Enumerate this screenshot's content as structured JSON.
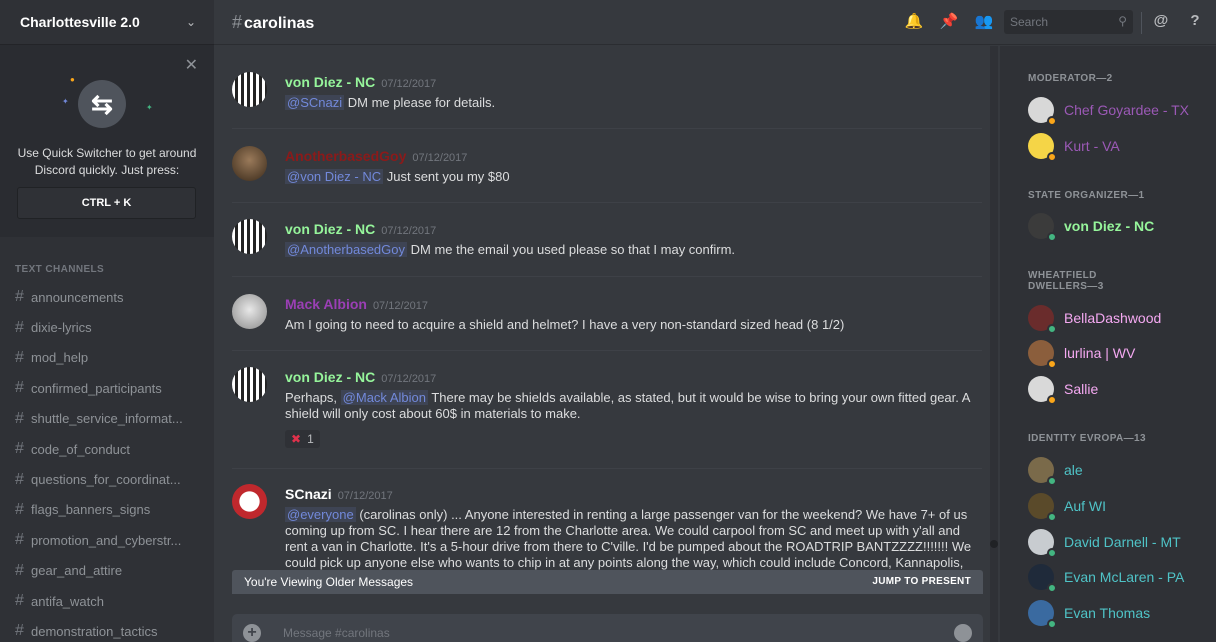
{
  "server": {
    "name": "Charlottesville 2.0"
  },
  "quick_switcher": {
    "text": "Use Quick Switcher to get around Discord quickly. Just press:",
    "shortcut": "CTRL + K"
  },
  "channels": {
    "category": "TEXT CHANNELS",
    "items": [
      "announcements",
      "dixie-lyrics",
      "mod_help",
      "confirmed_participants",
      "shuttle_service_informat...",
      "code_of_conduct",
      "questions_for_coordinat...",
      "flags_banners_signs",
      "promotion_and_cyberstr...",
      "gear_and_attire",
      "antifa_watch",
      "demonstration_tactics"
    ]
  },
  "header": {
    "channel": "carolinas",
    "search_placeholder": "Search",
    "at_label": "@",
    "help_label": "?"
  },
  "messages": [
    {
      "user": "von Diez - NC",
      "color": "#96f59b",
      "time": "07/12/2017",
      "mention": "@SCnazi",
      "text": "DM me please for details."
    },
    {
      "user": "AnotherbasedGoy",
      "color": "#8b1a1a",
      "time": "07/12/2017",
      "mention": "@von Diez - NC",
      "text": "Just sent you my $80"
    },
    {
      "user": "von Diez - NC",
      "color": "#96f59b",
      "time": "07/12/2017",
      "mention": "@AnotherbasedGoy",
      "text": "DM me the email you used please so that I may confirm."
    },
    {
      "user": "Mack Albion",
      "color": "#9b3fb5",
      "time": "07/12/2017",
      "mention": "",
      "text": "Am I going to need to acquire a shield and helmet? I have a very non-standard sized head (8 1/2)"
    },
    {
      "user": "von Diez - NC",
      "color": "#96f59b",
      "time": "07/12/2017",
      "mention_pre": "Perhaps,",
      "mention": "@Mack Albion",
      "text": "There may be shields available, as stated, but it would be wise to bring your own fitted gear. A shield will only cost about 60$ in materials to make.",
      "reaction_count": "1"
    },
    {
      "user": "SCnazi",
      "color": "#ffffff",
      "time": "07/12/2017",
      "mention": "@everyone",
      "text": "(carolinas only) ... Anyone interested in renting a large passenger van for the weekend? We have 7+ of us coming up from SC. I hear there are 12 from the Charlotte area. We could carpool from SC and meet up with y'all and rent a van in Charlotte. It's a 5-hour drive from there to C'ville. I'd be pumped about the ROADTRIP BANTZZZZ!!!!!!! We could pick up anyone else who wants to chip in at any points along the way, which could include Concord, Kannapolis, Salisbury, Lexington, Thomasville, High Point, Greensboro, Reidsville, etc. Alternately, if the demand"
    }
  ],
  "older_bar": {
    "text": "You're Viewing Older Messages",
    "jump": "JUMP TO PRESENT"
  },
  "composer": {
    "placeholder": "Message #carolinas"
  },
  "members": {
    "groups": [
      {
        "label": "MODERATOR—2",
        "items": [
          {
            "name": "Chef Goyardee - TX",
            "color": "#9b59b6",
            "status": "#faa61a",
            "av": "#d8d8d8"
          },
          {
            "name": "Kurt - VA",
            "color": "#9b59b6",
            "status": "#faa61a",
            "av": "#f5d547"
          }
        ]
      },
      {
        "label": "STATE ORGANIZER—1",
        "items": [
          {
            "name": "von Diez - NC",
            "color": "#96f59b",
            "status": "#43b581",
            "av": "#3b3b3b"
          }
        ]
      },
      {
        "label": "WHEATFIELD DWELLERS—3",
        "items": [
          {
            "name": "BellaDashwood",
            "color": "#f5a9f2",
            "status": "#43b581",
            "av": "#6a2c2c"
          },
          {
            "name": "lurlina | WV",
            "color": "#f5a9f2",
            "status": "#faa61a",
            "av": "#8b5e3c"
          },
          {
            "name": "Sallie",
            "color": "#f5a9f2",
            "status": "#faa61a",
            "av": "#d9d9d9"
          }
        ]
      },
      {
        "label": "IDENTITY EVROPA—13",
        "items": [
          {
            "name": "ale",
            "color": "#4fc3c7",
            "status": "#43b581",
            "av": "#7a6a4a"
          },
          {
            "name": "Auf WI",
            "color": "#4fc3c7",
            "status": "#43b581",
            "av": "#5a4a2a"
          },
          {
            "name": "David Darnell - MT",
            "color": "#4fc3c7",
            "status": "#43b581",
            "av": "#c8ccd0"
          },
          {
            "name": "Evan McLaren - PA",
            "color": "#4fc3c7",
            "status": "#43b581",
            "av": "#1f2a3a"
          },
          {
            "name": "Evan Thomas",
            "color": "#4fc3c7",
            "status": "#43b581",
            "av": "#3a6aa0"
          }
        ]
      }
    ]
  }
}
